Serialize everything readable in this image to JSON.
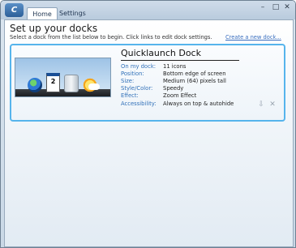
{
  "window": {
    "logo_text": "C",
    "tabs": [
      {
        "label": "Home",
        "active": true
      },
      {
        "label": "Settings",
        "active": false
      }
    ],
    "controls": {
      "minimize": "–",
      "maximize": "□",
      "close": "✕"
    }
  },
  "page": {
    "title": "Set up your docks",
    "instructions": "Select a dock from the list below to begin. Click links to edit dock settings.",
    "create_link": "Create a new dock..."
  },
  "dock": {
    "name": "Quicklaunch Dock",
    "preview_icons": [
      "windows-start-icon",
      "calendar-icon",
      "recycle-bin-icon",
      "weather-icon"
    ],
    "calendar_day": "2",
    "properties": [
      {
        "label": "On my dock:",
        "value": "11 icons"
      },
      {
        "label": "Position:",
        "value": "Bottom edge of screen"
      },
      {
        "label": "Size:",
        "value": "Medium (64) pixels tall"
      },
      {
        "label": "Style/Color:",
        "value": "Speedy"
      },
      {
        "label": "Effect:",
        "value": "Zoom Effect"
      },
      {
        "label": "Accessibility:",
        "value": "Always on top & autohide"
      }
    ],
    "actions": {
      "export_glyph": "⇩",
      "delete_glyph": "✕"
    }
  },
  "colors": {
    "accent_border": "#56b4ec",
    "label_blue": "#2f6fb8",
    "link_blue": "#3a6fbf"
  }
}
